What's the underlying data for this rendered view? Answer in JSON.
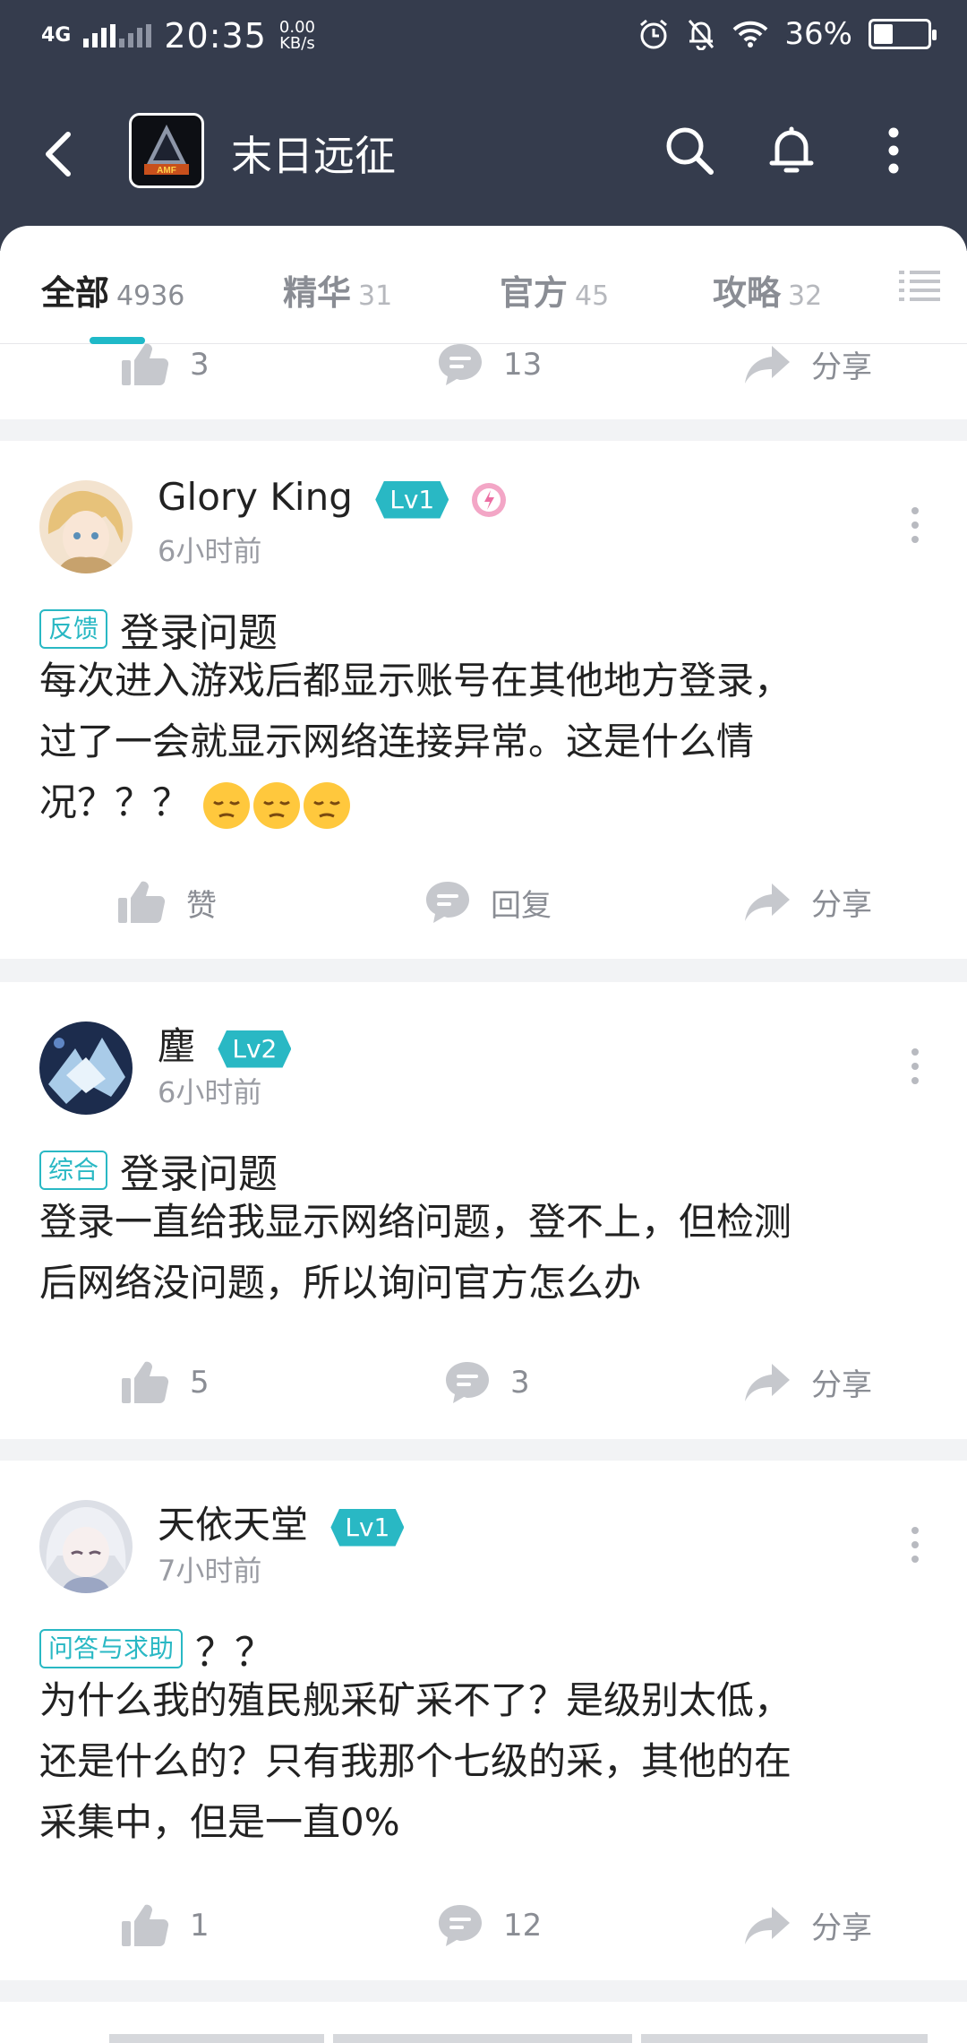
{
  "status_bar": {
    "network": "4G",
    "time": "20:35",
    "speed_value": "0.00",
    "speed_unit": "KB/s",
    "battery": "36%",
    "battery_level": 0.36
  },
  "header": {
    "title": "末日远征",
    "logo_text": "AMF"
  },
  "tabs": [
    {
      "label": "全部",
      "count": "4936"
    },
    {
      "label": "精华",
      "count": "31"
    },
    {
      "label": "官方",
      "count": "45"
    },
    {
      "label": "攻略",
      "count": "32"
    }
  ],
  "partial_card": {
    "likes": "3",
    "comments": "13",
    "share": "分享"
  },
  "posts": [
    {
      "username": "Glory King",
      "level": "Lv1",
      "time": "6小时前",
      "tag": "反馈",
      "title": "登录问题",
      "body_lines": [
        "每次进入游戏后都显示账号在其他地方登录，",
        "过了一会就显示网络连接异常。这是什么情",
        "况？？？"
      ],
      "likes": "赞",
      "comments": "回复",
      "share": "分享"
    },
    {
      "username": "麈",
      "level": "Lv2",
      "time": "6小时前",
      "tag": "综合",
      "title": "登录问题",
      "body_lines": [
        "登录一直给我显示网络问题，登不上，但检测",
        "后网络没问题，所以询问官方怎么办"
      ],
      "likes": "5",
      "comments": "3",
      "share": "分享"
    },
    {
      "username": "天依天堂",
      "level": "Lv1",
      "time": "7小时前",
      "tag": "问答与求助",
      "title": "？？",
      "body_lines": [
        "为什么我的殖民舰采矿采不了？是级别太低，",
        "还是什么的？只有我那个七级的采，其他的在",
        "采集中，但是一直0%"
      ],
      "likes": "1",
      "comments": "12",
      "share": "分享"
    }
  ],
  "colors": {
    "header_bg": "#353c4d",
    "accent": "#29b8c4",
    "muted": "#8a8d94"
  }
}
